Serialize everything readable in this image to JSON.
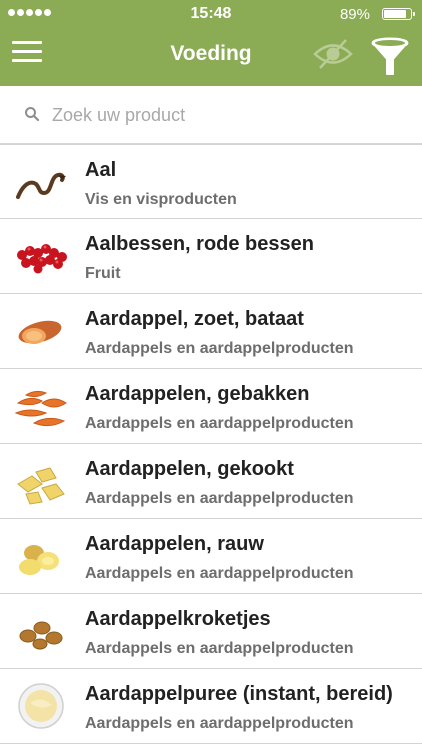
{
  "status_bar": {
    "time": "15:48",
    "battery_percent": "89%",
    "battery_level": 0.89,
    "signal_dots": 5
  },
  "header": {
    "title": "Voeding"
  },
  "search": {
    "placeholder": "Zoek uw product",
    "value": ""
  },
  "colors": {
    "header_bg": "#8bab55",
    "eye_icon": "#b9cc96"
  },
  "products": [
    {
      "title": "Aal",
      "category": "Vis en visproducten",
      "icon": "eel-icon"
    },
    {
      "title": "Aalbessen, rode bessen",
      "category": "Fruit",
      "icon": "redcurrant-icon"
    },
    {
      "title": "Aardappel, zoet, bataat",
      "category": "Aardappels en aardappelproducten",
      "icon": "sweet-potato-icon"
    },
    {
      "title": "Aardappelen, gebakken",
      "category": "Aardappels en aardappelproducten",
      "icon": "fried-potatoes-icon"
    },
    {
      "title": "Aardappelen, gekookt",
      "category": "Aardappels en aardappelproducten",
      "icon": "boiled-potatoes-icon"
    },
    {
      "title": "Aardappelen, rauw",
      "category": "Aardappels en aardappelproducten",
      "icon": "raw-potatoes-icon"
    },
    {
      "title": "Aardappelkroketjes",
      "category": "Aardappels en aardappelproducten",
      "icon": "croquettes-icon"
    },
    {
      "title": "Aardappelpuree (instant, bereid)",
      "category": "Aardappels en aardappelproducten",
      "icon": "mashed-potatoes-icon"
    }
  ]
}
